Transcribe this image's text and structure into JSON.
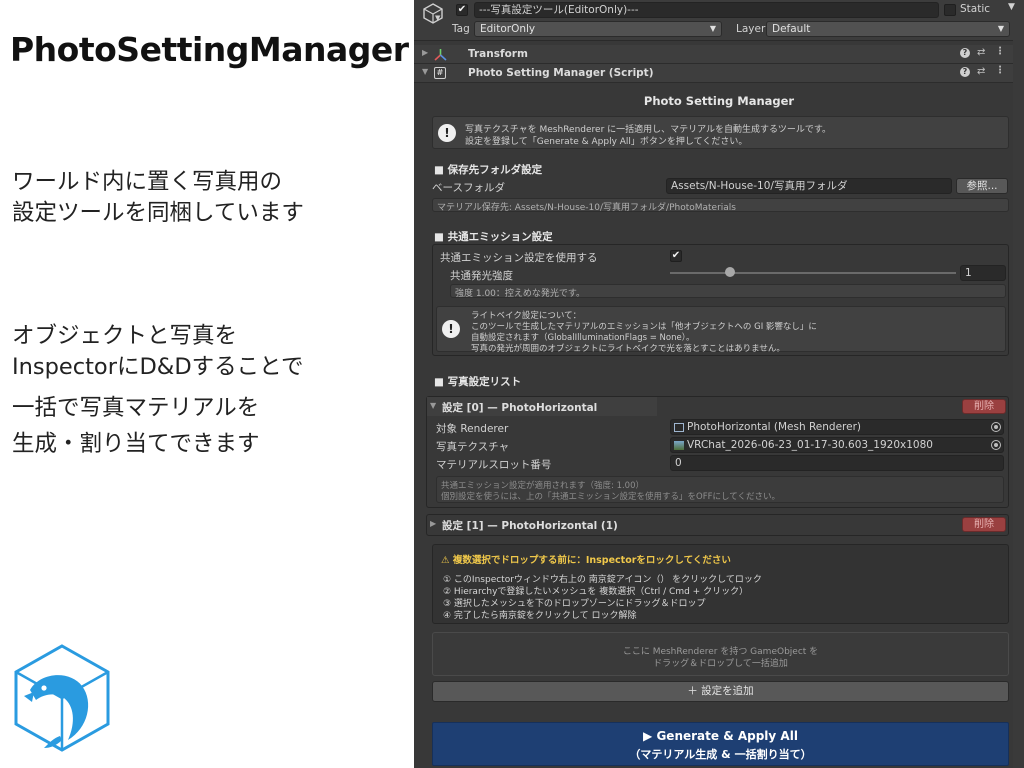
{
  "slide": {
    "title": "PhotoSettingManager",
    "line1": "ワールド内に置く写真用の",
    "line2": "設定ツールを同梱しています",
    "line3": "オブジェクトと写真を",
    "line4": "InspectorにD&Dすることで",
    "line5": "一括で写真マテリアルを",
    "line6": "生成・割り当てできます"
  },
  "header": {
    "object_name": "---写真設定ツール(EditorOnly)---",
    "static_label": "Static",
    "tag_label": "Tag",
    "tag_value": "EditorOnly",
    "layer_label": "Layer",
    "layer_value": "Default"
  },
  "components": {
    "transform": "Transform",
    "script": "Photo Setting Manager (Script)"
  },
  "manager": {
    "title": "Photo Setting Manager",
    "info_line1": "写真テクスチャを MeshRenderer に一括適用し、マテリアルを自動生成するツールです。",
    "info_line2": "設定を登録して「Generate & Apply All」ボタンを押してください。"
  },
  "save_folder": {
    "heading": "■ 保存先フォルダ設定",
    "base_label": "ベースフォルダ",
    "base_value": "Assets/N-House-10/写真用フォルダ",
    "browse_label": "参照...",
    "material_path": "マテリアル保存先: Assets/N-House-10/写真用フォルダ/PhotoMaterials"
  },
  "emission": {
    "heading": "■ 共通エミッション設定",
    "use_label": "共通エミッション設定を使用する",
    "use_checked": true,
    "intensity_label": "共通発光強度",
    "intensity_value": "1",
    "intensity_fraction": 0.21,
    "intensity_note": "強度 1.00：控えめな発光です。",
    "bake_line1": "ライトベイク設定について：",
    "bake_line2": "このツールで生成したマテリアルのエミッションは「他オブジェクトへの GI 影響なし」に",
    "bake_line3": "自動設定されます（GlobalIlluminationFlags = None）。",
    "bake_line4": "写真の発光が周囲のオブジェクトにライトベイクで光を落とすことはありません。"
  },
  "photo_list": {
    "heading": "■ 写真設定リスト",
    "delete_label": "削除",
    "item0": {
      "title": "設定 [0] — PhotoHorizontal",
      "renderer_label": "対象 Renderer",
      "renderer_value": "PhotoHorizontal (Mesh Renderer)",
      "texture_label": "写真テクスチャ",
      "texture_value": "VRChat_2026-06-23_01-17-30.603_1920x1080",
      "slot_label": "マテリアルスロット番号",
      "slot_value": "0",
      "note1": "共通エミッション設定が適用されます（強度: 1.00）",
      "note2": "個別設定を使うには、上の「共通エミッション設定を使用する」をOFFにしてください。"
    },
    "item1": {
      "title": "設定 [1] — PhotoHorizontal (1)"
    }
  },
  "warning": {
    "title": "⚠ 複数選択でドロップする前に：Inspectorをロックしてください",
    "step1": "① このInspectorウィンドウ右上の 南京錠アイコン（） をクリックしてロック",
    "step2": "② Hierarchyで登録したいメッシュを 複数選択（Ctrl / Cmd + クリック）",
    "step3": "③ 選択したメッシュを下のドロップゾーンにドラッグ＆ドロップ",
    "step4": "④ 完了したら南京錠をクリックして ロック解除"
  },
  "dropzone": {
    "line1": "ここに MeshRenderer を持つ GameObject を",
    "line2": "ドラッグ＆ドロップして一括追加"
  },
  "buttons": {
    "add_setting": "＋ 設定を追加",
    "generate_line1": "▶ Generate & Apply All",
    "generate_line2": "（マテリアル生成 & 一括割り当て）"
  },
  "colors": {
    "inspector_bg": "#383838",
    "generate_button": "#1e3f73",
    "delete_button": "#9a4040",
    "logo_blue": "#2a9be0"
  }
}
